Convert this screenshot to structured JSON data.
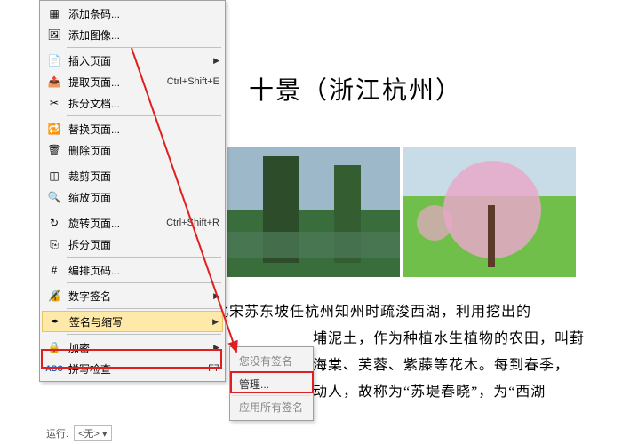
{
  "menu": {
    "items": [
      {
        "label": "添加条码...",
        "shortcut": "",
        "submenu": false,
        "icon": "barcode"
      },
      {
        "label": "添加图像...",
        "shortcut": "",
        "submenu": false,
        "icon": "image"
      },
      {
        "sep": true
      },
      {
        "label": "插入页面",
        "shortcut": "",
        "submenu": true,
        "icon": "page-plus"
      },
      {
        "label": "提取页面...",
        "shortcut": "Ctrl+Shift+E",
        "submenu": false,
        "icon": "page-extract"
      },
      {
        "label": "拆分文档...",
        "shortcut": "",
        "submenu": false,
        "icon": "split"
      },
      {
        "sep": true
      },
      {
        "label": "替换页面...",
        "shortcut": "",
        "submenu": false,
        "icon": "replace"
      },
      {
        "label": "删除页面",
        "shortcut": "",
        "submenu": false,
        "icon": "page-delete"
      },
      {
        "sep": true
      },
      {
        "label": "裁剪页面",
        "shortcut": "",
        "submenu": false,
        "icon": "crop"
      },
      {
        "label": "缩放页面",
        "shortcut": "",
        "submenu": false,
        "icon": "zoom-page"
      },
      {
        "sep": true
      },
      {
        "label": "旋转页面...",
        "shortcut": "Ctrl+Shift+R",
        "submenu": false,
        "icon": "rotate"
      },
      {
        "label": "拆分页面",
        "shortcut": "",
        "submenu": false,
        "icon": "split-page"
      },
      {
        "sep": true
      },
      {
        "label": "编排页码...",
        "shortcut": "",
        "submenu": false,
        "icon": "pagenum"
      },
      {
        "sep": true
      },
      {
        "label": "数字签名",
        "shortcut": "",
        "submenu": true,
        "icon": "digisig"
      },
      {
        "sep": true
      },
      {
        "label": "签名与缩写",
        "shortcut": "",
        "submenu": true,
        "icon": "sign",
        "highlight": true
      },
      {
        "sep": true
      },
      {
        "label": "加密",
        "shortcut": "",
        "submenu": true,
        "icon": "encrypt"
      },
      {
        "label": "拼写检查",
        "shortcut": "F7",
        "submenu": false,
        "icon": "spell"
      }
    ]
  },
  "submenu": {
    "items": [
      {
        "label": "您没有签名",
        "enabled": false
      },
      {
        "label": "管理...",
        "enabled": true
      },
      {
        "label": "应用所有签名",
        "enabled": false
      }
    ]
  },
  "statusbar": {
    "label": "运行:",
    "value": "<无>"
  },
  "doc": {
    "title": "十景（浙江杭州）",
    "lines": [
      "是北宋苏东坡任杭州知州时疏浚西湖，利用挖出的",
      "埔泥土，作为种植水生植物的农田，叫葑",
      "海棠、芙蓉、紫藤等花木。每到春季，",
      "动人，故称为“苏堤春晓”，为“西湖"
    ]
  },
  "icons": {
    "barcode": "▦",
    "image": "🖼",
    "page-plus": "📄",
    "page-extract": "📤",
    "split": "✂",
    "replace": "🔁",
    "page-delete": "🗑",
    "crop": "◫",
    "zoom-page": "🔍",
    "rotate": "↻",
    "split-page": "⎘",
    "pagenum": "#",
    "digisig": "🔏",
    "sign": "✒",
    "encrypt": "🔒",
    "spell": "ABC"
  }
}
